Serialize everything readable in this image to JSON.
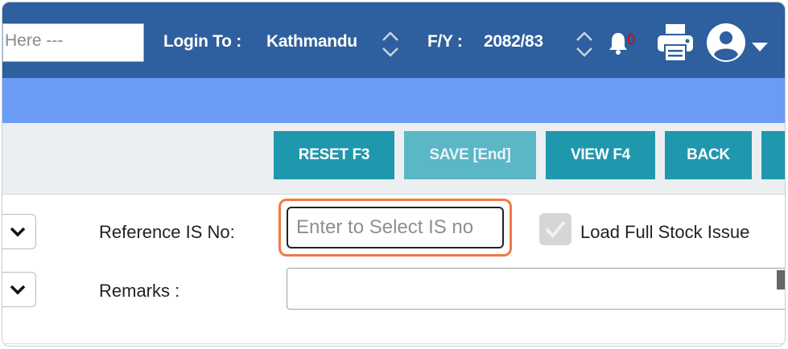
{
  "header": {
    "search_placeholder": "Here ---",
    "login_label": "Login To :",
    "login_value": "Kathmandu",
    "fy_label": "F/Y :",
    "fy_value": "2082/83",
    "notification_count": "0",
    "icons": [
      "chevron-updown-icon",
      "bell-icon",
      "printer-icon",
      "user-avatar-icon",
      "caret-down-icon"
    ],
    "colors": {
      "header_bg": "#2e5f9e",
      "accent_bar": "#6a9cf5"
    }
  },
  "toolbar": {
    "reset_label": "RESET F3",
    "save_label": "SAVE [End]",
    "view_label": "VIEW F4",
    "back_label": "BACK",
    "colors": {
      "button": "#1f97ad",
      "button_disabled": "#5bb6c5"
    }
  },
  "form": {
    "reference_label": "Reference IS No:",
    "reference_placeholder": "Enter to Select IS no",
    "reference_value": "",
    "load_full_label": "Load Full Stock Issue",
    "load_full_checked": true,
    "remarks_label": "Remarks :",
    "remarks_value": ""
  }
}
